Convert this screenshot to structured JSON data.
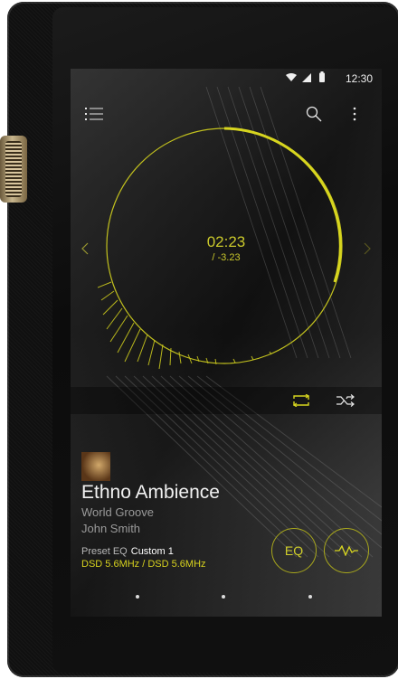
{
  "status": {
    "time": "12:30"
  },
  "player": {
    "elapsed": "02:23",
    "remaining": "/ -3.23"
  },
  "track": {
    "title": "Ethno Ambience",
    "album": "World Groove",
    "artist": "John Smith",
    "preset_label": "Preset EQ",
    "preset_value": "Custom 1",
    "format": "DSD 5.6MHz / DSD 5.6MHz"
  },
  "buttons": {
    "eq_label": "EQ"
  },
  "colors": {
    "accent": "#d1cf2a",
    "screen_bg": "#111111"
  },
  "icons": [
    "menu-icon",
    "search-icon",
    "more-vert-icon",
    "repeat-icon",
    "shuffle-icon",
    "waveform-icon",
    "wifi-icon",
    "cellular-icon",
    "battery-icon",
    "previous-arrow-icon",
    "next-arrow-icon"
  ]
}
